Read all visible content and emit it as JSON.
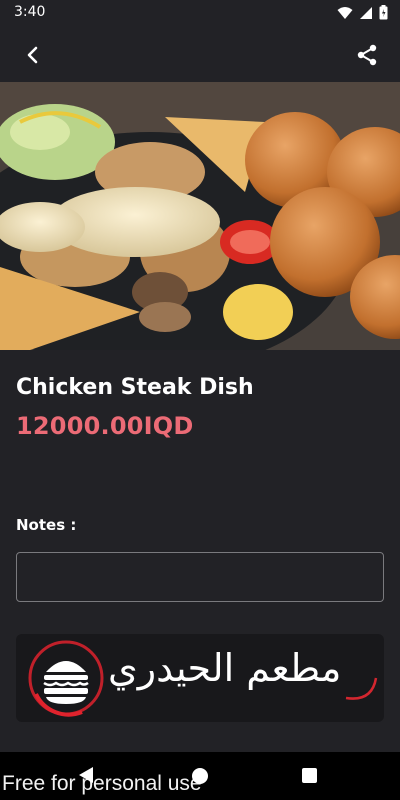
{
  "status_bar": {
    "time": "3:40"
  },
  "top_bar": {
    "back_icon": "chevron-left-icon",
    "share_icon": "share-icon"
  },
  "hero": {
    "expand_icon": "expand-diagonal-icon"
  },
  "item": {
    "name": "Chicken Steak Dish",
    "price": "12000.00IQD"
  },
  "notes": {
    "label": "Notes :",
    "value": "",
    "placeholder": ""
  },
  "logo": {
    "text": "مطعم الحيدري"
  },
  "nav_bar": {
    "back_icon": "triangle-back-icon",
    "home_icon": "circle-home-icon",
    "recent_icon": "square-recent-icon"
  },
  "watermark": {
    "text": "Free for personal use"
  },
  "colors": {
    "background": "#222226",
    "price": "#ec6b76",
    "accent": "#e05a65",
    "logo_card": "#18181b"
  }
}
